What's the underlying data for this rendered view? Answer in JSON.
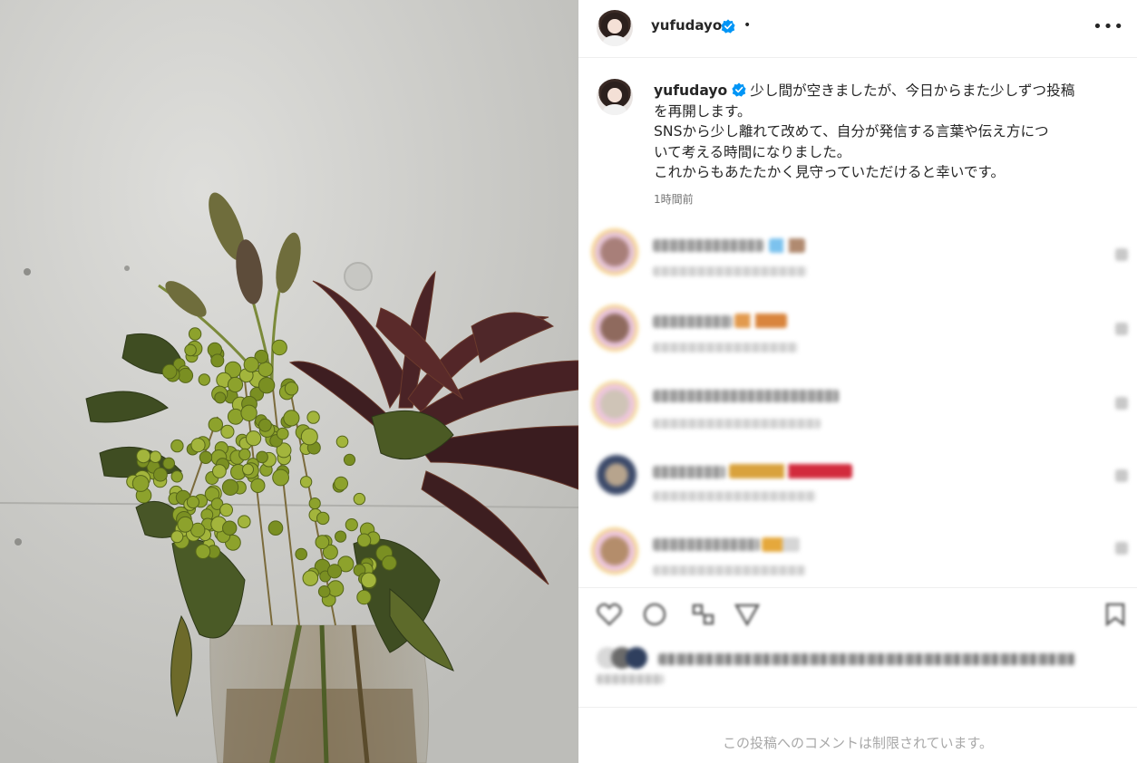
{
  "post": {
    "username": "yufudayo",
    "verified": true,
    "header_separator": "•",
    "more_label": "•••",
    "caption_lines": [
      "少し間が空きましたが、今日からまた少しずつ投稿",
      "を再開します。",
      "SNSから少し離れて改めて、自分が発信する言葉や伝え方につ",
      "いて考える時間になりました。",
      "これからもあたたかく見守っていただけると幸いです。"
    ],
    "time_ago": "1時間前",
    "comments_restricted": "この投稿へのコメントは制限されています。"
  },
  "colors": {
    "verified_badge": "#0095f6",
    "muted_text": "#737373",
    "restricted_text": "#a8a8a8",
    "divider": "#efefef"
  },
  "icons": {
    "verified": "verified-badge-icon",
    "more": "more-options-icon",
    "like": "heart-icon",
    "comment": "comment-icon",
    "share": "share-icon",
    "send": "send-icon",
    "save": "bookmark-icon"
  }
}
